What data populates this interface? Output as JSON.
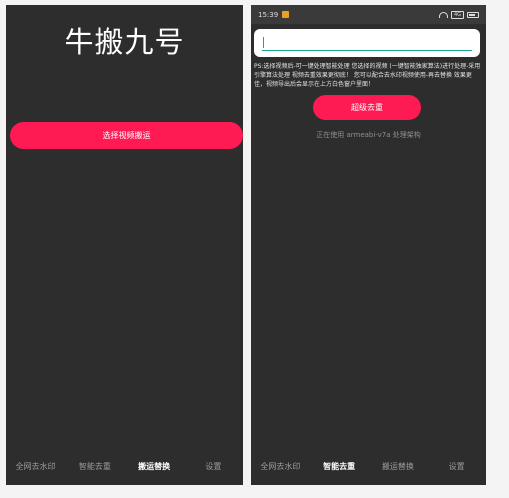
{
  "left_screen": {
    "title": "牛搬九号",
    "select_button_label": "选择视频搬运",
    "nav": [
      {
        "label": "全网去水印",
        "active": false
      },
      {
        "label": "智能去重",
        "active": false
      },
      {
        "label": "搬运替换",
        "active": true
      },
      {
        "label": "设置",
        "active": false
      }
    ]
  },
  "right_screen": {
    "status_bar": {
      "time": "15:39",
      "battery_label": "4G",
      "icons": [
        "app-notification-icon",
        "wifi-icon",
        "battery-icon"
      ]
    },
    "input": {
      "value": "",
      "placeholder": ""
    },
    "ps_text": "PS:选择视频后-可一键处理智能处理 您选择的视频 (一键智能独家算法)进行处理-采用引擎算法处理 视频去重效果更彻底！ 您可以配合去水印视频使用-再去替换 效果更佳，视频导出后会显示在上方白色窗户里面！",
    "dedupe_button_label": "超级去重",
    "arch_text": "正在使用 armeabi-v7a 处理架构",
    "nav": [
      {
        "label": "全网去水印",
        "active": false
      },
      {
        "label": "智能去重",
        "active": true
      },
      {
        "label": "搬运替换",
        "active": false
      },
      {
        "label": "设置",
        "active": false
      }
    ]
  },
  "colors": {
    "accent": "#fe1a53",
    "background": "#2d2d2d",
    "input_underline": "#1aa38f"
  }
}
